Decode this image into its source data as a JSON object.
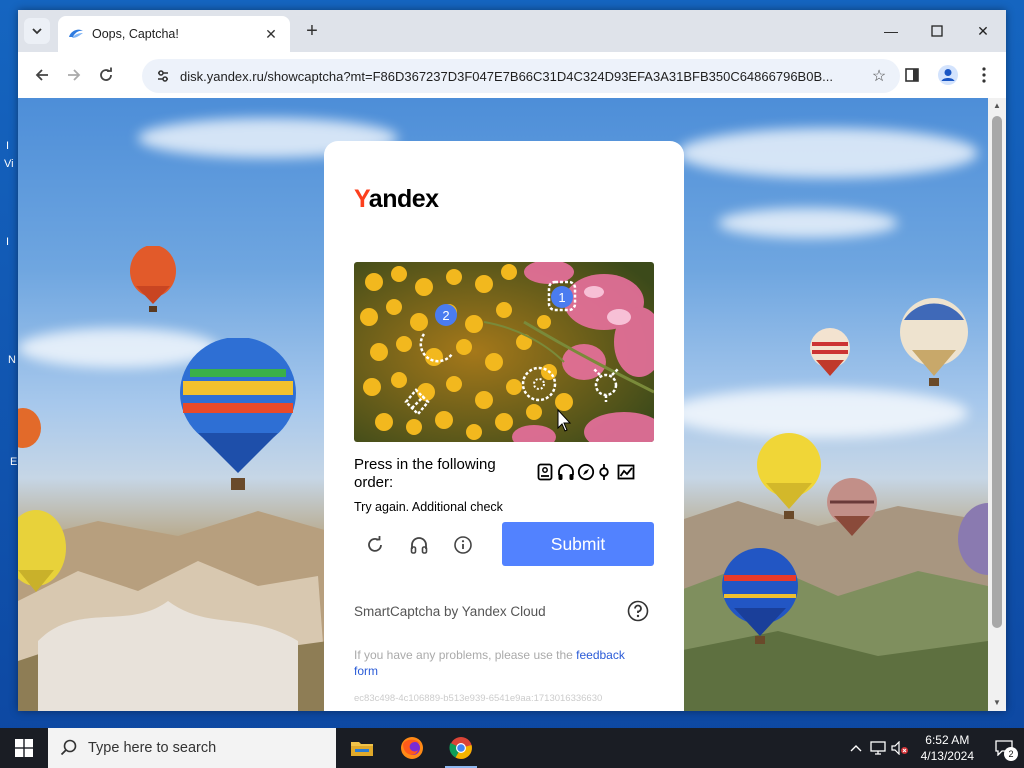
{
  "desktop": {
    "left_labels": [
      "I",
      "Vi",
      "I",
      "N",
      "E"
    ]
  },
  "browser": {
    "tab": {
      "title": "Oops, Captcha!"
    },
    "address": {
      "url": "disk.yandex.ru/showcaptcha?mt=F86D367237D3F047E7B66C31D4C324D93EFA3A31BFB350C64866796B0B..."
    }
  },
  "captcha": {
    "brand_first": "Y",
    "brand_rest": "andex",
    "order_label": "Press in the following order:",
    "try_again": "Try again. Additional check",
    "submit_label": "Submit",
    "smartcaptcha_label": "SmartCaptcha by Yandex Cloud",
    "feedback_prefix": "If you have any problems, please use the ",
    "feedback_link": "feedback form",
    "hash": "ec83c498-4c106889-b513e939-6541e9aa:1713016336630",
    "markers": [
      "1",
      "2"
    ]
  },
  "taskbar": {
    "search_placeholder": "Type here to search",
    "time": "6:52 AM",
    "date": "4/13/2024",
    "notification_count": "2"
  },
  "colors": {
    "yandex_red": "#fc3f1d",
    "submit_blue": "#5282ff",
    "marker_blue": "#4a7cf0",
    "link_blue": "#2a5bd7"
  }
}
